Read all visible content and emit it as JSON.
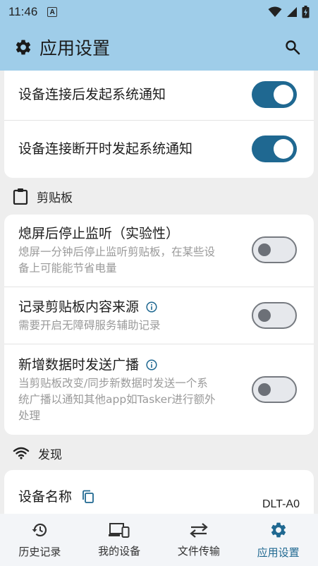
{
  "status_bar": {
    "time": "11:46",
    "notif_letter": "A"
  },
  "app_bar": {
    "title": "应用设置"
  },
  "connection_card": {
    "items": [
      {
        "title": "设备连接后发起系统通知",
        "enabled": true
      },
      {
        "title": "设备连接断开时发起系统通知",
        "enabled": true
      }
    ]
  },
  "clipboard_section": {
    "header": "剪贴板",
    "items": [
      {
        "title": "熄屏后停止监听（实验性）",
        "subtitle_lines": [
          "熄屏一分钟后停止监听剪贴板，在某些设",
          "备上可能能节省电量"
        ],
        "enabled": false
      },
      {
        "title": "记录剪贴板内容来源",
        "subtitle_lines": [
          "需要开启无障碍服务辅助记录"
        ],
        "enabled": false
      },
      {
        "title": "新增数据时发送广播",
        "subtitle_lines": [
          "当剪贴板改变/同步新数据时发送一个系",
          "统广播以通知其他app如Tasker进行额外",
          "处理"
        ],
        "enabled": false
      }
    ]
  },
  "discovery_section": {
    "header": "发现",
    "device_name_label": "设备名称",
    "device_name_value": "DLT-A0"
  },
  "bottom_nav": {
    "items": [
      {
        "label": "历史记录",
        "icon": "history-icon"
      },
      {
        "label": "我的设备",
        "icon": "devices-icon"
      },
      {
        "label": "文件传输",
        "icon": "swap-icon"
      },
      {
        "label": "应用设置",
        "icon": "gear-icon",
        "active": true
      }
    ]
  },
  "colors": {
    "accent": "#1f6891",
    "app_bar": "#9fcde9"
  }
}
